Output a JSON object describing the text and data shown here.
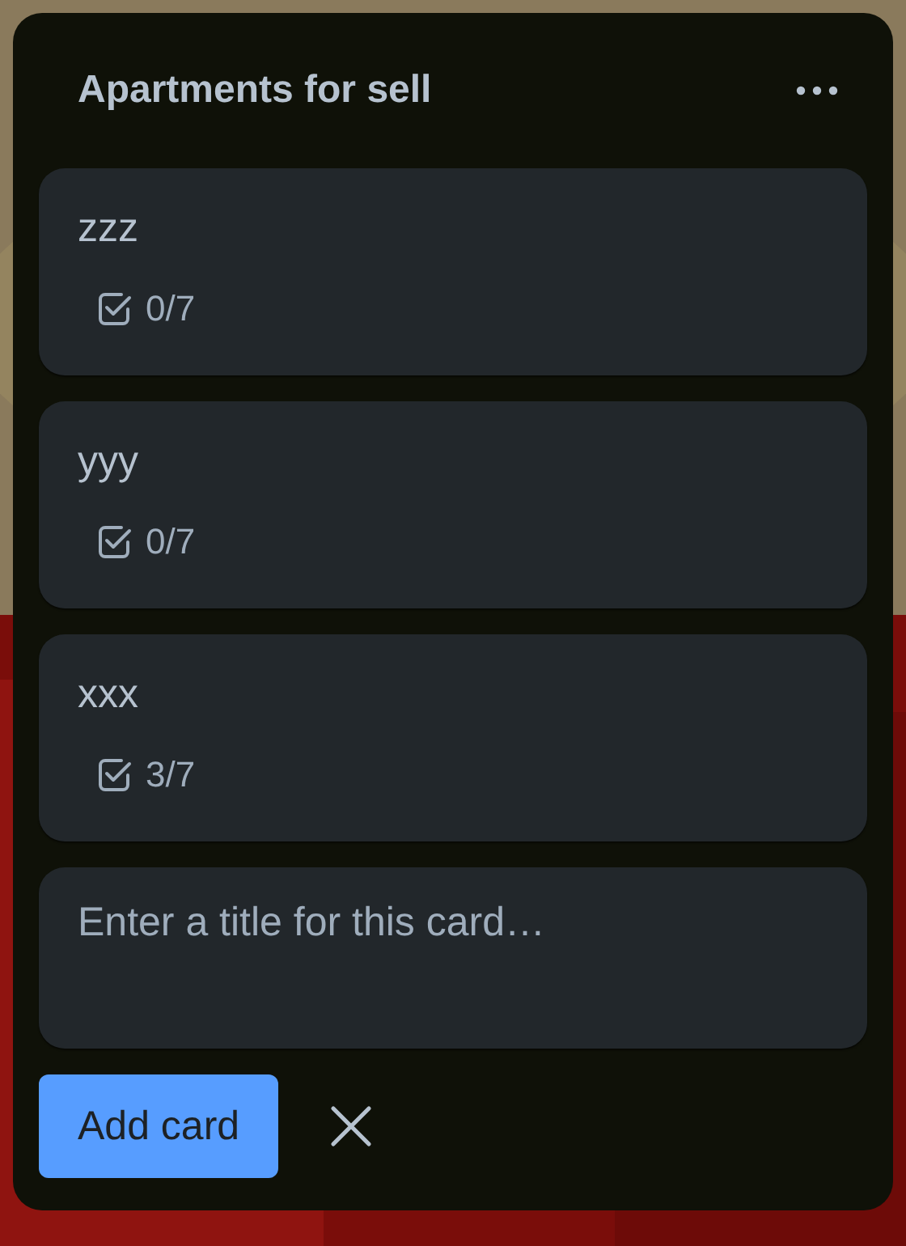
{
  "list": {
    "title": "Apartments for sell"
  },
  "cards": [
    {
      "title": "zzz",
      "checklist": "0/7"
    },
    {
      "title": "yyy",
      "checklist": "0/7"
    },
    {
      "title": "xxx",
      "checklist": "3/7"
    }
  ],
  "composer": {
    "placeholder": "Enter a title for this card…",
    "submit": "Add card"
  }
}
